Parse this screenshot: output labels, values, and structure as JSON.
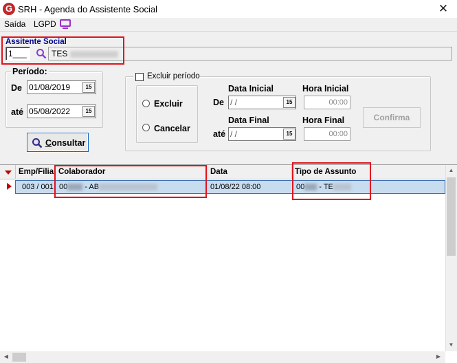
{
  "window": {
    "title": "SRH - Agenda do Assistente Social",
    "logo_letter": "G",
    "close_symbol": "✕"
  },
  "menu": {
    "items": [
      "Saída",
      "LGPD"
    ]
  },
  "assistente": {
    "label": "Assitente Social",
    "code": "1___",
    "name_prefix": "TES"
  },
  "periodo": {
    "label": "Período:",
    "de_label": "De",
    "de_value": "01/08/2019",
    "ate_label": "até",
    "ate_value": "05/08/2022",
    "cal_icon_text": "15"
  },
  "consultar_button": {
    "label_first": "C",
    "label_rest": "onsultar"
  },
  "excluir": {
    "checkbox_label": "Excluir período",
    "radio_excluir": "Excluir",
    "radio_cancelar": "Cancelar",
    "data_inicial_label": "Data Inicial",
    "hora_inicial_label": "Hora Inicial",
    "data_final_label": "Data Final",
    "hora_final_label": "Hora Final",
    "de_label": "De",
    "ate_label": "até",
    "date_empty": " /  /",
    "time_empty": "00:00",
    "confirma_label": "Confirma"
  },
  "grid": {
    "columns": [
      "Emp/Filial",
      "Colaborador",
      "Data",
      "Tipo de Assunto"
    ],
    "rows": [
      {
        "emp_filial": "003 /  001",
        "colaborador_prefix": "00",
        "colaborador_mid": " - AB",
        "data": "01/08/22 08:00",
        "assunto_prefix": "00",
        "assunto_mid": " - TE"
      }
    ]
  },
  "colors": {
    "accent_red": "#e0141e",
    "label_blue": "#00008b",
    "selection": "#c8dcf0",
    "lgpd_icon": "#9b2fc7"
  }
}
